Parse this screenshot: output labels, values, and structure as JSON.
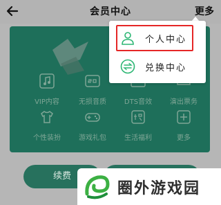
{
  "header": {
    "title": "会员中心",
    "more_label": "更多"
  },
  "menu": {
    "items": [
      {
        "label": "个人中心",
        "icon": "user-icon"
      },
      {
        "label": "兑换中心",
        "icon": "exchange-icon"
      }
    ],
    "accent": "#2bb673",
    "highlight_color": "#e52626"
  },
  "card": {
    "color": "#1e6f5a",
    "features": [
      {
        "label": "VIP内容",
        "icon": "music-note-icon"
      },
      {
        "label": "无损音质",
        "icon": "sq-quality-icon"
      },
      {
        "label": "DTS音效",
        "icon": "dts-icon"
      },
      {
        "label": "演出票务",
        "icon": "ticket-icon"
      },
      {
        "label": "个性装扮",
        "icon": "tshirt-icon"
      },
      {
        "label": "游戏礼包",
        "icon": "gamepad-icon"
      },
      {
        "label": "生活福利",
        "icon": "discount-icon"
      },
      {
        "label": "更多",
        "icon": "plus-icon"
      }
    ]
  },
  "buttons": {
    "renew_label": "续费"
  },
  "watermark": {
    "text": "圈外游戏园"
  }
}
